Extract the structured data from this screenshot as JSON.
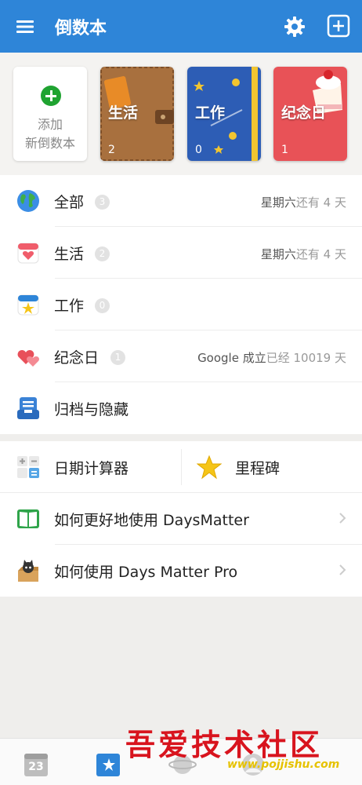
{
  "app": {
    "title": "倒数本"
  },
  "add_card": {
    "line1": "添加",
    "line2": "新倒数本"
  },
  "books": [
    {
      "name": "生活",
      "count": "2",
      "color": "#a8703e"
    },
    {
      "name": "工作",
      "count": "0",
      "color": "#2d5db5"
    },
    {
      "name": "纪念日",
      "count": "1",
      "color": "#e85257"
    }
  ],
  "categories": [
    {
      "label": "全部",
      "badge": "3",
      "right_strong": "星期六",
      "right_rest": "还有 4 天",
      "icon": "globe-icon"
    },
    {
      "label": "生活",
      "badge": "2",
      "right_strong": "星期六",
      "right_rest": "还有 4 天",
      "icon": "calendar-heart-icon"
    },
    {
      "label": "工作",
      "badge": "0",
      "right_strong": "",
      "right_rest": "",
      "icon": "calendar-star-icon"
    },
    {
      "label": "纪念日",
      "badge": "1",
      "right_strong": "Google 成立",
      "right_rest": "已经 10019 天",
      "icon": "hearts-icon"
    },
    {
      "label": "归档与隐藏",
      "badge": "",
      "right_strong": "",
      "right_rest": "",
      "icon": "archive-icon"
    }
  ],
  "tools": {
    "calculator": "日期计算器",
    "milestone": "里程碑"
  },
  "help": [
    {
      "label": "如何更好地使用 DaysMatter",
      "icon": "book-icon"
    },
    {
      "label": "如何使用 Days Matter Pro",
      "icon": "cat-box-icon"
    }
  ],
  "tabbar": {
    "calendar_number": "23"
  },
  "watermark": {
    "text": "吾爱技术社区",
    "url": "www.pojjishu.com"
  }
}
